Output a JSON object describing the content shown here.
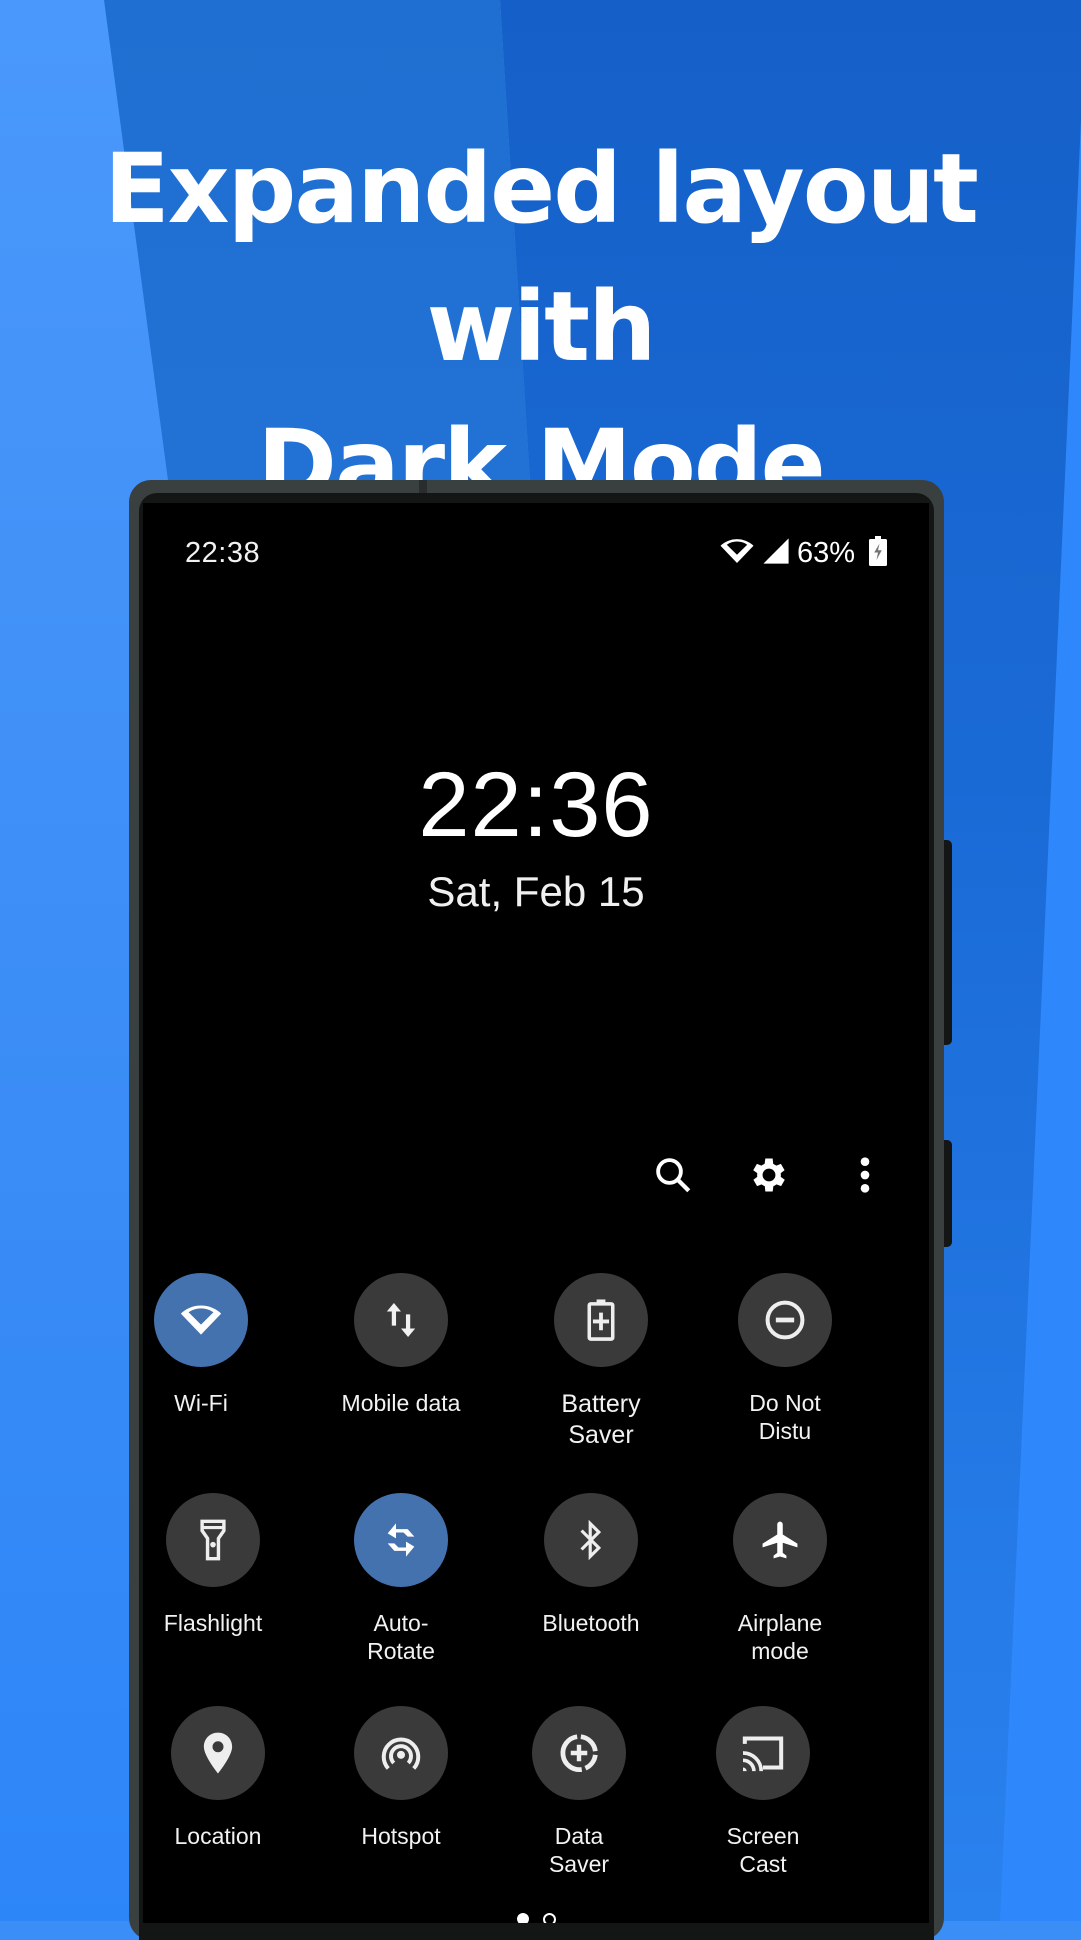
{
  "promo": {
    "headline_line1": "Expanded layout with",
    "headline_line2": "Dark Mode"
  },
  "status_bar": {
    "time": "22:38",
    "battery_percent": "63%",
    "icons": [
      "wifi-icon",
      "cell-signal-icon",
      "battery-charging-icon"
    ]
  },
  "lock_clock": {
    "time": "22:36",
    "date": "Sat, Feb 15"
  },
  "header_actions": [
    {
      "name": "search",
      "icon": "search-icon"
    },
    {
      "name": "settings",
      "icon": "gear-icon"
    },
    {
      "name": "more",
      "icon": "more-vert-icon"
    }
  ],
  "tiles": [
    {
      "label": "Wi-Fi",
      "icon": "wifi-icon",
      "active": true
    },
    {
      "label": "Mobile data",
      "icon": "mobile-data-icon",
      "active": false
    },
    {
      "label": "Battery\nSaver",
      "icon": "battery-saver-icon",
      "active": false
    },
    {
      "label": "Do Not\nDistu",
      "icon": "do-not-disturb-icon",
      "active": false
    },
    {
      "label": "Flashlight",
      "icon": "flashlight-icon",
      "active": false
    },
    {
      "label": "Auto-\nRotate",
      "icon": "auto-rotate-icon",
      "active": true
    },
    {
      "label": "Bluetooth",
      "icon": "bluetooth-icon",
      "active": false
    },
    {
      "label": "Airplane\nmode",
      "icon": "airplane-icon",
      "active": false
    },
    {
      "label": "Location",
      "icon": "location-icon",
      "active": false
    },
    {
      "label": "Hotspot",
      "icon": "hotspot-icon",
      "active": false
    },
    {
      "label": "Data\nSaver",
      "icon": "data-saver-icon",
      "active": false
    },
    {
      "label": "Screen\nCast",
      "icon": "cast-icon",
      "active": false
    }
  ],
  "pager": {
    "pages": 2,
    "current": 1
  },
  "colors": {
    "active_tile": "#4472ae",
    "inactive_tile": "#3a3a3a",
    "background_blue": "#3b8ef5"
  }
}
